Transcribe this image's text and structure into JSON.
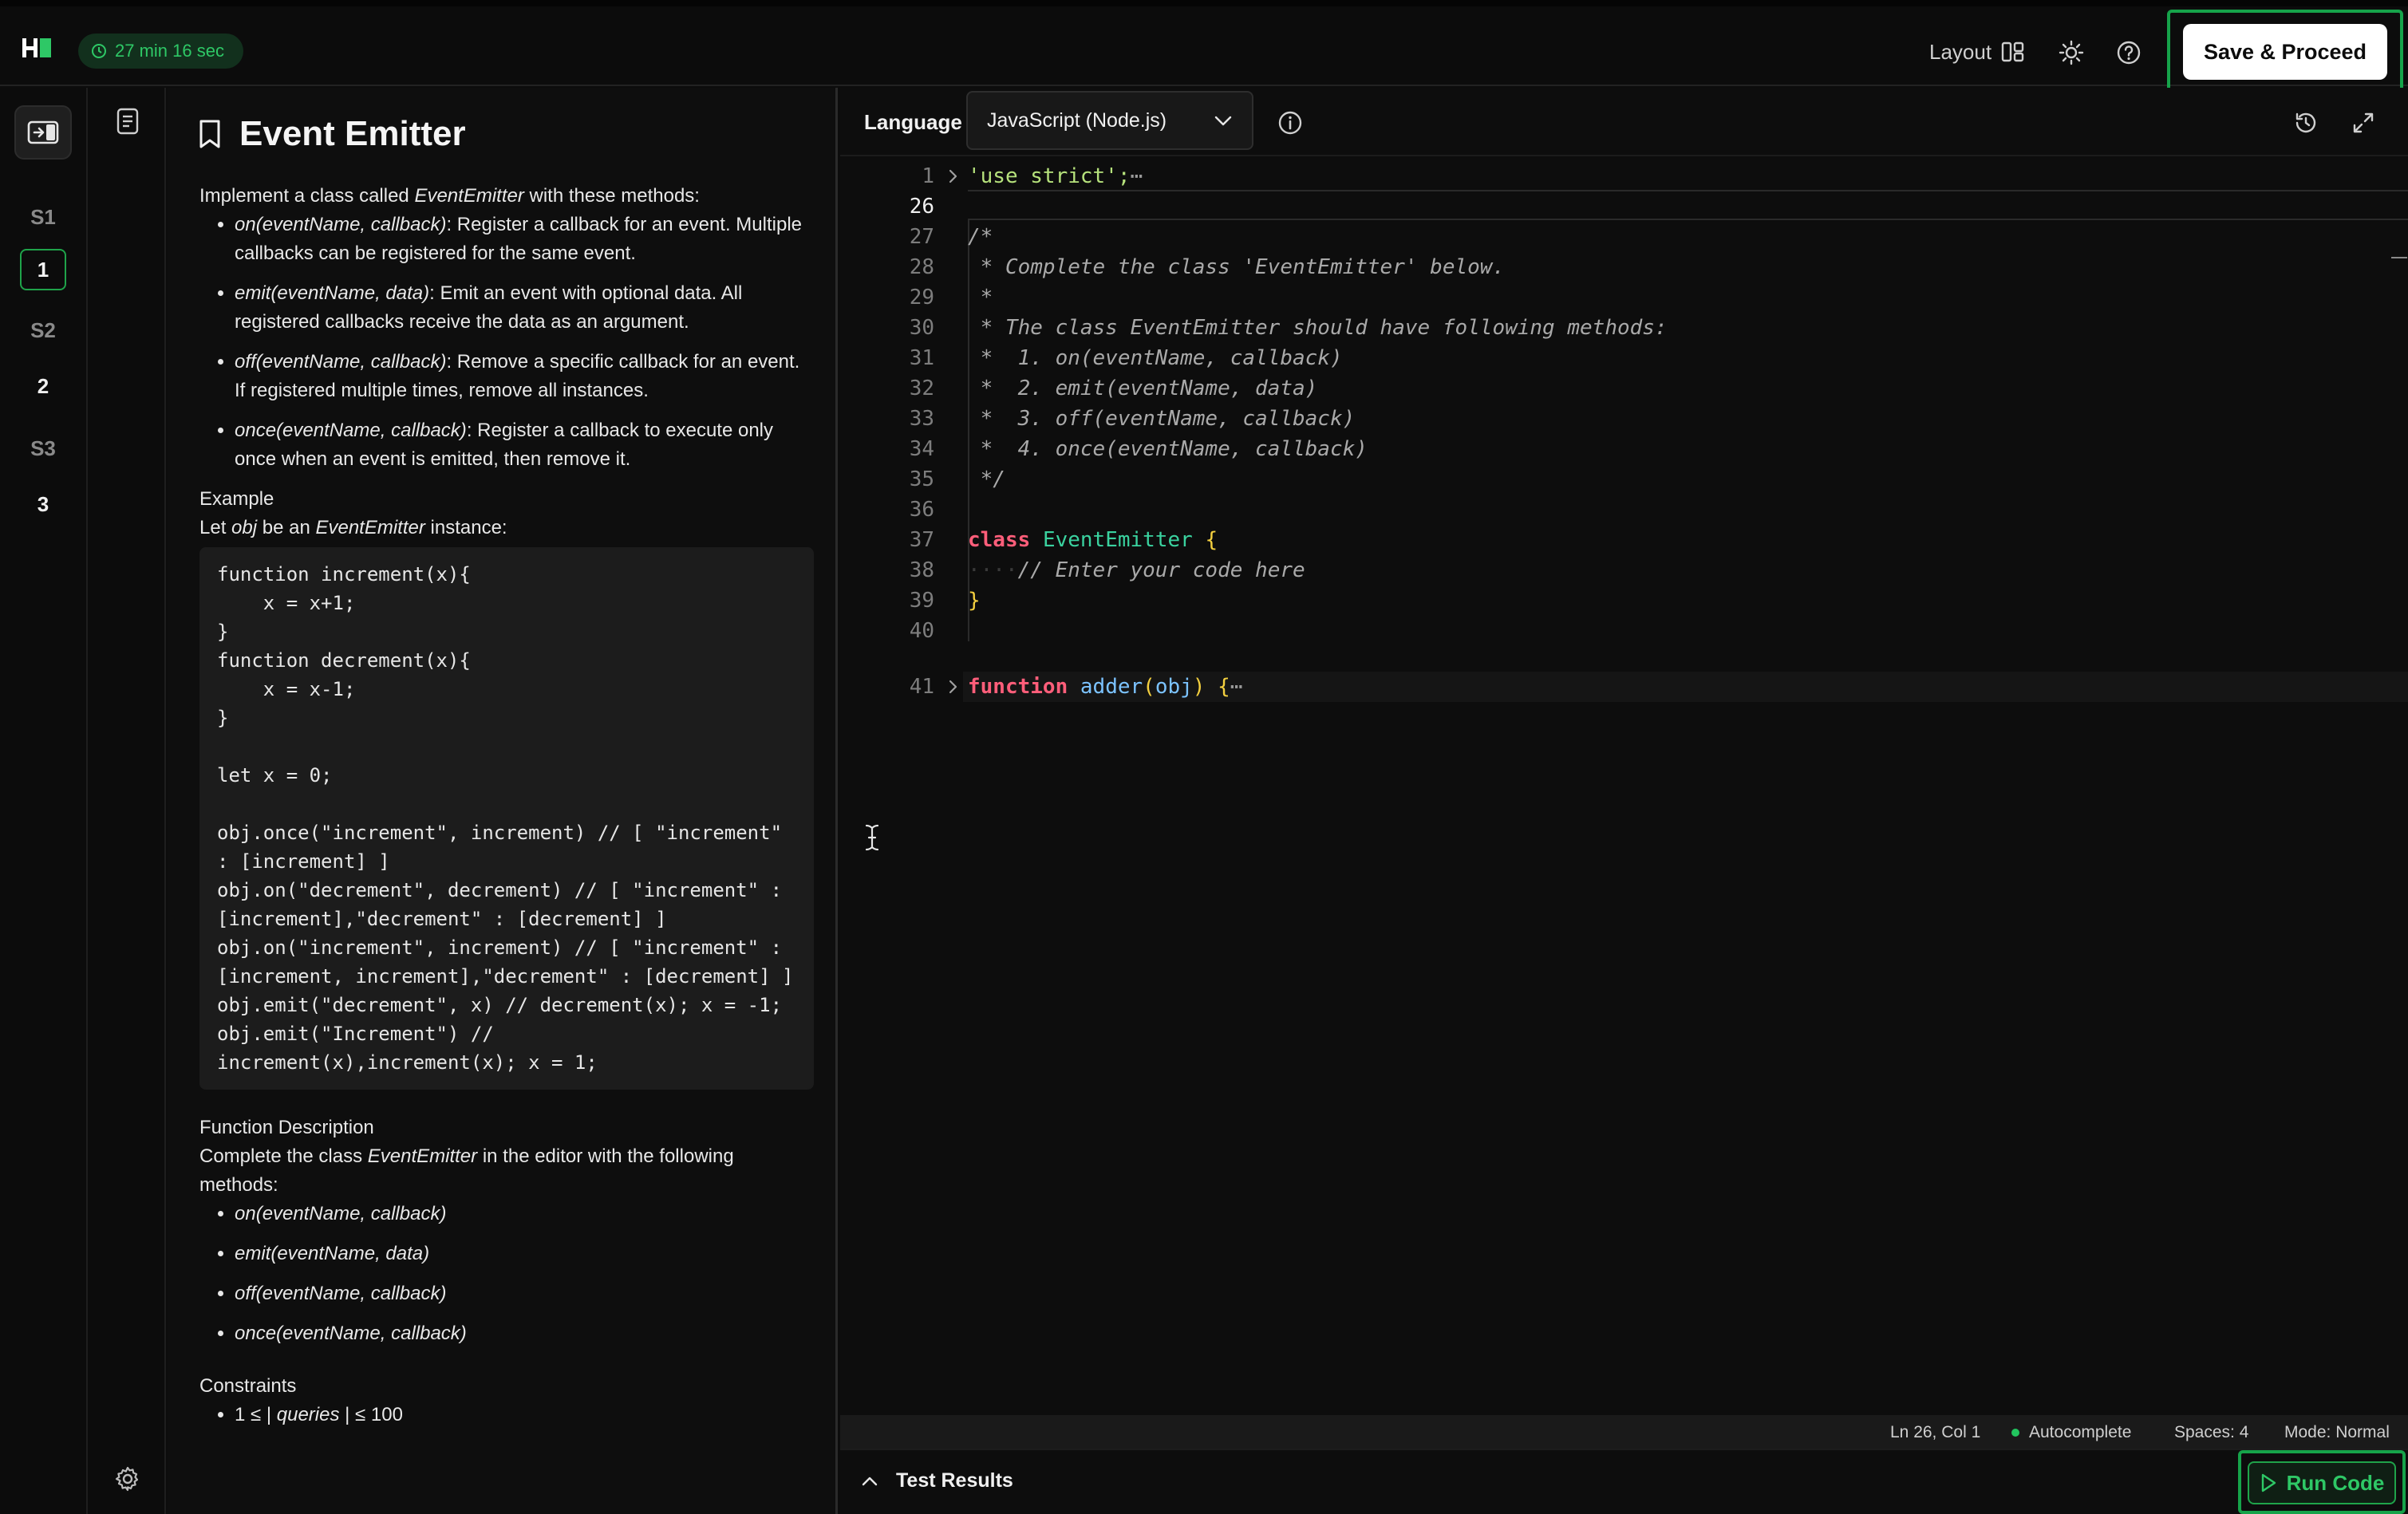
{
  "header": {
    "logo_text": "H",
    "timer": "27 min 16 sec",
    "layout_label": "Layout",
    "save_label": "Save & Proceed"
  },
  "rail": {
    "items": [
      "S1",
      "1",
      "S2",
      "2",
      "S3",
      "3"
    ]
  },
  "problem": {
    "title": "Event Emitter",
    "intro_pre": "Implement a class called ",
    "intro_class": "EventEmitter",
    "intro_post": " with these methods:",
    "methods": [
      {
        "sig": "on(eventName, callback)",
        "desc": ": Register a callback for an event. Multiple callbacks can be registered for the same event."
      },
      {
        "sig": "emit(eventName, data)",
        "desc": ": Emit an event with optional data. All registered callbacks receive the data as an argument."
      },
      {
        "sig": "off(eventName, callback)",
        "desc": ": Remove a specific callback for an event. If registered multiple times, remove all instances."
      },
      {
        "sig": "once(eventName, callback)",
        "desc": ": Register a callback to execute only once when an event is emitted, then remove it."
      }
    ],
    "example_heading": "Example",
    "example_pre": "Let ",
    "example_obj": "obj",
    "example_mid": " be an ",
    "example_class": "EventEmitter",
    "example_post": " instance:",
    "example_code": "function increment(x){\n    x = x+1;\n}\nfunction decrement(x){\n    x = x-1;\n}\n\nlet x = 0;\n\nobj.once(\"increment\", increment) // [ \"increment\" : [increment] ]\nobj.on(\"decrement\", decrement) // [ \"increment\" : [increment],\"decrement\" : [decrement] ]\nobj.on(\"increment\", increment) // [ \"increment\" : [increment, increment],\"decrement\" : [decrement] ]\nobj.emit(\"decrement\", x) // decrement(x); x = -1;\nobj.emit(\"Increment\") // increment(x),increment(x); x = 1;",
    "fd_heading": "Function Description",
    "fd_pre": "Complete the class ",
    "fd_class": "EventEmitter",
    "fd_post": " in the editor with the following methods:",
    "fd_methods": [
      "on(eventName, callback)",
      "emit(eventName, data)",
      "off(eventName, callback)",
      "once(eventName, callback)"
    ],
    "constraints_heading": "Constraints",
    "constraint_1_pre": "1 ≤ |",
    "constraint_1_var": " queries",
    "constraint_1_post": " | ≤ 100"
  },
  "editor": {
    "language_label": "Language",
    "language_value": "JavaScript (Node.js)",
    "line_numbers": [
      "1",
      "26",
      "27",
      "28",
      "29",
      "30",
      "31",
      "32",
      "33",
      "34",
      "35",
      "36",
      "37",
      "38",
      "39",
      "40",
      "41"
    ],
    "lines": {
      "l1": "'use strict';",
      "l27": "/*",
      "l28": " * Complete the class 'EventEmitter' below.",
      "l29": " *",
      "l30": " * The class EventEmitter should have following methods:",
      "l31": " *  1. on(eventName, callback)",
      "l32": " *  2. emit(eventName, data)",
      "l33": " *  3. off(eventName, callback)",
      "l34": " *  4. once(eventName, callback)",
      "l35": " */",
      "l37_kw": "class",
      "l37_name": "EventEmitter",
      "l37_brace": "{",
      "l38": "// Enter your code here",
      "l39": "}",
      "l41_kw": "function",
      "l41_name": "adder",
      "l41_open": "(",
      "l41_param": "obj",
      "l41_close": ")",
      "l41_brace": "{",
      "ellipsis": "⋯",
      "indent_dots": "····"
    }
  },
  "status": {
    "position": "Ln 26, Col 1",
    "autocomplete": "Autocomplete",
    "spaces": "Spaces: 4",
    "mode": "Mode: Normal"
  },
  "results": {
    "label": "Test Results",
    "run_label": "Run Code"
  },
  "colors": {
    "accent_green": "#16a34a",
    "keyword": "#ff5e7a",
    "class_name": "#3ad29f",
    "string": "#b6e27c"
  }
}
